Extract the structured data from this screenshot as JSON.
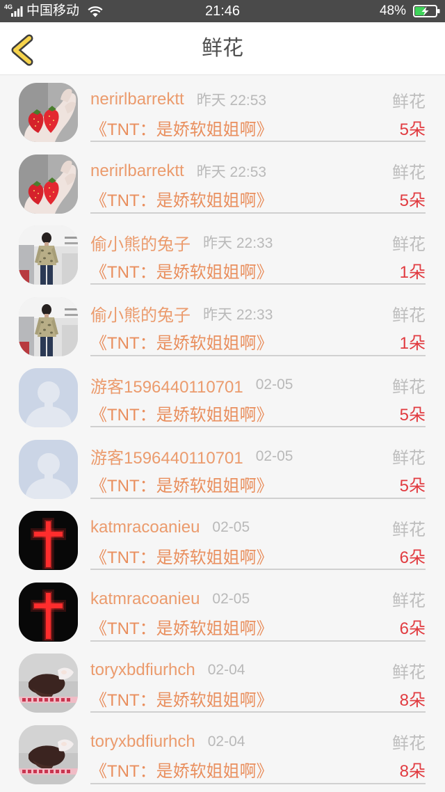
{
  "status_bar": {
    "network": "4G",
    "carrier": "中国移动",
    "time": "21:46",
    "battery": "48%",
    "signal_icon": "signal-icon",
    "wifi_icon": "wifi-icon",
    "battery_icon": "battery-charging-icon"
  },
  "header": {
    "back_icon": "chevron-left-icon",
    "title": "鲜花"
  },
  "colors": {
    "status_bar_bg": "#4a4a4a",
    "back_icon": "#f6d34c",
    "name_text": "#eb9b6d",
    "book_text": "#e98f5e",
    "count_text": "#e13b40",
    "battery_fill": "#3fd35a"
  },
  "rows": [
    {
      "avatar_icon": "strawberry-avatar-icon",
      "name": "nerirlbarrektt",
      "time": "昨天 22:53",
      "gift": "鲜花",
      "book": "《TNT：是娇软姐姐啊》",
      "count": "5朵"
    },
    {
      "avatar_icon": "strawberry-avatar-icon",
      "name": "nerirlbarrektt",
      "time": "昨天 22:53",
      "gift": "鲜花",
      "book": "《TNT：是娇软姐姐啊》",
      "count": "5朵"
    },
    {
      "avatar_icon": "standing-person-avatar-icon",
      "name": "偷小熊的兔子",
      "time": "昨天 22:33",
      "gift": "鲜花",
      "book": "《TNT：是娇软姐姐啊》",
      "count": "1朵"
    },
    {
      "avatar_icon": "standing-person-avatar-icon",
      "name": "偷小熊的兔子",
      "time": "昨天 22:33",
      "gift": "鲜花",
      "book": "《TNT：是娇软姐姐啊》",
      "count": "1朵"
    },
    {
      "avatar_icon": "default-user-avatar-icon",
      "name": "游客1596440110701",
      "time": "02-05",
      "gift": "鲜花",
      "book": "《TNT：是娇软姐姐啊》",
      "count": "5朵"
    },
    {
      "avatar_icon": "default-user-avatar-icon",
      "name": "游客1596440110701",
      "time": "02-05",
      "gift": "鲜花",
      "book": "《TNT：是娇软姐姐啊》",
      "count": "5朵"
    },
    {
      "avatar_icon": "red-cross-avatar-icon",
      "name": "katmracoanieu",
      "time": "02-05",
      "gift": "鲜花",
      "book": "《TNT：是娇软姐姐啊》",
      "count": "6朵"
    },
    {
      "avatar_icon": "red-cross-avatar-icon",
      "name": "katmracoanieu",
      "time": "02-05",
      "gift": "鲜花",
      "book": "《TNT：是娇软姐姐啊》",
      "count": "6朵"
    },
    {
      "avatar_icon": "lying-girl-avatar-icon",
      "name": "toryxbdfiurhch",
      "time": "02-04",
      "gift": "鲜花",
      "book": "《TNT：是娇软姐姐啊》",
      "count": "8朵"
    },
    {
      "avatar_icon": "lying-girl-avatar-icon",
      "name": "toryxbdfiurhch",
      "time": "02-04",
      "gift": "鲜花",
      "book": "《TNT：是娇软姐姐啊》",
      "count": "8朵"
    }
  ]
}
